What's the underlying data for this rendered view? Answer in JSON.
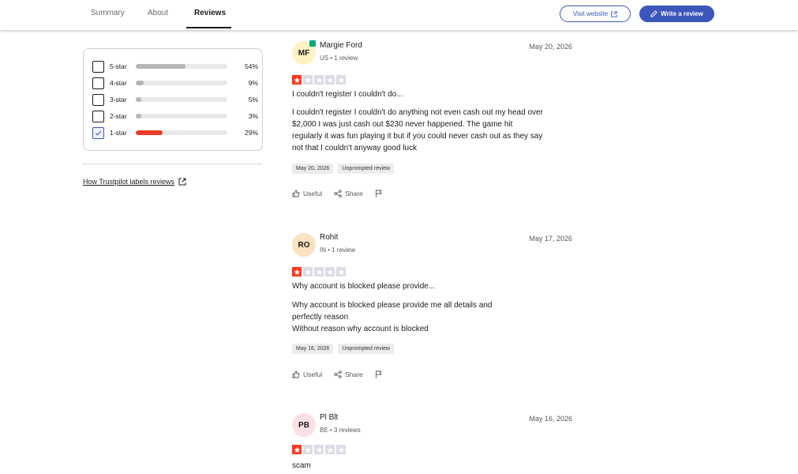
{
  "header": {
    "tabs": [
      {
        "label": "Summary"
      },
      {
        "label": "About"
      },
      {
        "label": "Reviews"
      }
    ],
    "visit_label": "Visit website",
    "write_label": "Write a review"
  },
  "filter": {
    "rows": [
      {
        "label": "5-star",
        "pct": "54%",
        "fraction": 0.54,
        "checked": false
      },
      {
        "label": "4-star",
        "pct": "9%",
        "fraction": 0.09,
        "checked": false
      },
      {
        "label": "3-star",
        "pct": "5%",
        "fraction": 0.05,
        "checked": false
      },
      {
        "label": "2-star",
        "pct": "3%",
        "fraction": 0.03,
        "checked": false
      },
      {
        "label": "1-star",
        "pct": "29%",
        "fraction": 0.29,
        "checked": true
      }
    ],
    "how_link": "How Trustpilot labels reviews"
  },
  "colors": {
    "accent": "#3c57bc",
    "star_red": "#ff3722",
    "star_empty": "#dcdce6",
    "verified": "#04a77b"
  },
  "reviews": [
    {
      "initials": "MF",
      "avatar_bg": "#fff2c4",
      "name": "Margie Ford",
      "meta": "US • 1 review",
      "date": "May 20, 2026",
      "rating": 1,
      "title": "I couldn't register I couldn't do...",
      "body": "I couldn't register I couldn't do anything not even cash out my head over\n$2,000 I was just cash out $230 never happened. The game hit\nregularly it was fun playing it but if you could never cash out as they say\nnot that I couldn't anyway good luck",
      "chips": [
        "May 20, 2026",
        "Unprompted review"
      ],
      "useful": "Useful",
      "share": "Share"
    },
    {
      "initials": "RO",
      "avatar_bg": "#fde2c2",
      "name": "Rohit",
      "meta": "IN • 1 review",
      "date": "May 17, 2026",
      "rating": 1,
      "title": "Why account is blocked please provide...",
      "body": "Why account is blocked please provide me all details and\nperfectly reason\nWithout reason why account is blocked",
      "chips": [
        "May 16, 2026",
        "Unprompted review"
      ],
      "useful": "Useful",
      "share": "Share"
    },
    {
      "initials": "PB",
      "avatar_bg": "#fde1e6",
      "name": "Pl Blt",
      "meta": "BE • 3 reviews",
      "date": "May 16, 2026",
      "rating": 1,
      "title": "scam"
    }
  ]
}
